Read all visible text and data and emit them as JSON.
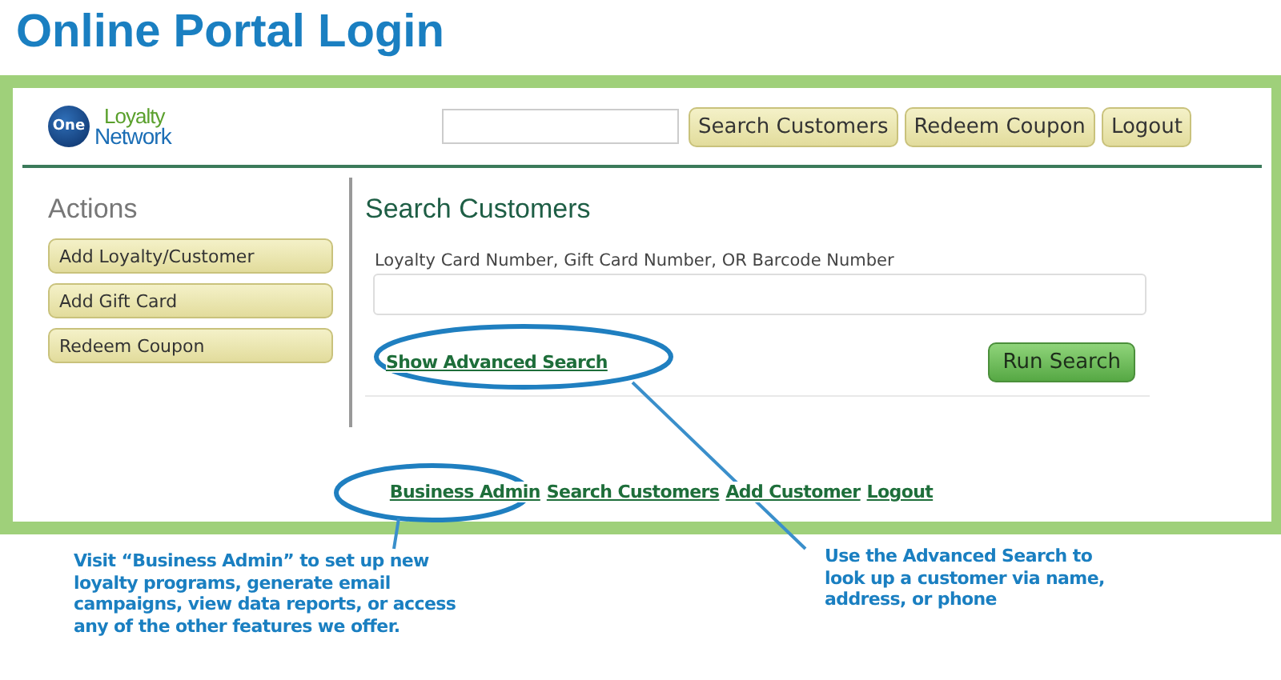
{
  "page_title": "Online Portal Login",
  "header": {
    "logo": {
      "badge": "One",
      "line_1": "Loyalty",
      "line_2": "Network"
    },
    "nav_buttons": [
      "Search Customers",
      "Redeem Coupon",
      "Logout"
    ]
  },
  "sidebar": {
    "heading": "Actions",
    "buttons": [
      "Add Loyalty/Customer",
      "Add Gift Card",
      "Redeem Coupon"
    ]
  },
  "main": {
    "heading": "Search Customers",
    "field_label": "Loyalty Card Number, Gift Card Number, OR Barcode Number",
    "advanced_link": "Show Advanced Search",
    "run_button": "Run Search"
  },
  "footer_links": [
    "Business Admin",
    "Search Customers",
    "Add Customer",
    "Logout"
  ],
  "annotations": [
    {
      "text": "Visit “Business Admin” to set up new loyalty programs, generate email campaigns, view data reports, or access any of the other features we offer."
    },
    {
      "text": "Use the Advanced Search to look up a customer via name, address, or phone"
    }
  ]
}
